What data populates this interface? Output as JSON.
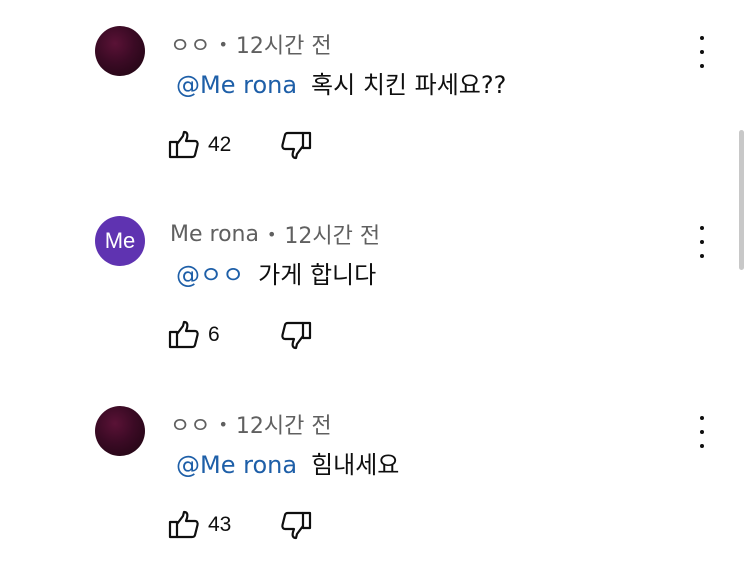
{
  "comments": [
    {
      "author": "ㅇㅇ",
      "separator": "•",
      "time": "12시간 전",
      "mention": "@Me rona",
      "text": "혹시 치킨 파세요??",
      "likes": "42",
      "avatar": {
        "type": "image",
        "color": "#3a0a24"
      }
    },
    {
      "author": "Me rona",
      "separator": "•",
      "time": "12시간 전",
      "mention": "@ㅇㅇ",
      "text": "가게 합니다",
      "likes": "6",
      "avatar": {
        "type": "letter",
        "letter": "Me",
        "color": "#5f33b1"
      }
    },
    {
      "author": "ㅇㅇ",
      "separator": "•",
      "time": "12시간 전",
      "mention": "@Me rona",
      "text": "힘내세요",
      "likes": "43",
      "avatar": {
        "type": "image",
        "color": "#3a0a24"
      }
    }
  ],
  "icons": {
    "like": "thumbs-up-icon",
    "dislike": "thumbs-down-icon",
    "more": "more-vertical-icon"
  },
  "colors": {
    "mention": "#1e5fa8",
    "meta": "#606060",
    "text": "#0f0f0f"
  }
}
